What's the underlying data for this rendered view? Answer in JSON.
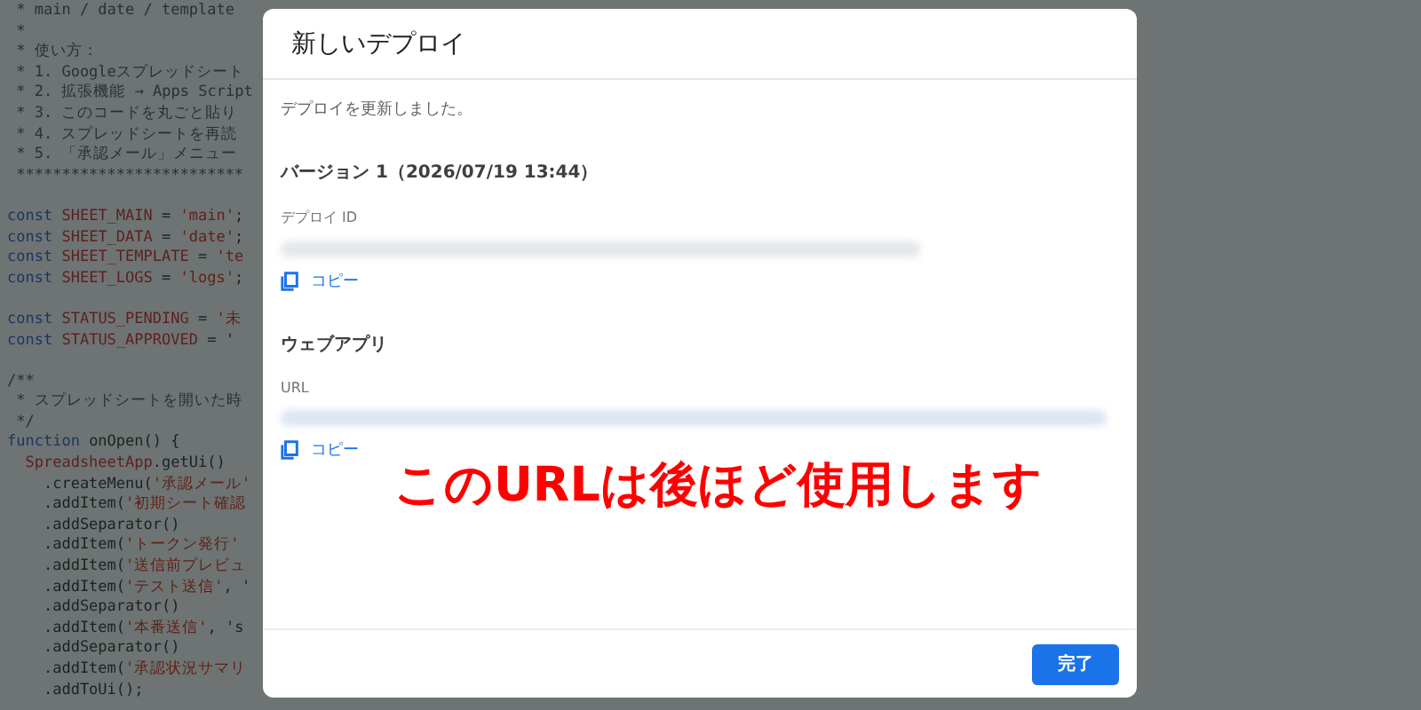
{
  "editor": {
    "blocks": [
      [
        [
          {
            "kind": "comment",
            "text": " * main / date / template"
          }
        ],
        [
          {
            "kind": "comment",
            "text": " *"
          }
        ],
        [
          {
            "kind": "comment",
            "text": " * 使い方："
          }
        ],
        [
          {
            "kind": "comment",
            "text": " * 1. Googleスプレッドシート"
          }
        ],
        [
          {
            "kind": "comment",
            "text": " * 2. 拡張機能 → Apps Script"
          }
        ],
        [
          {
            "kind": "comment",
            "text": " * 3. このコードを丸ごと貼り"
          }
        ],
        [
          {
            "kind": "comment",
            "text": " * 4. スプレッドシートを再読"
          }
        ],
        [
          {
            "kind": "comment",
            "text": " * 5. 「承認メール」メニュー"
          }
        ],
        [
          {
            "kind": "comment",
            "text": " *************************"
          }
        ]
      ],
      [
        [
          {
            "kind": "keyword",
            "text": "const "
          },
          {
            "kind": "name",
            "text": "SHEET_MAIN"
          },
          {
            "kind": "plain",
            "text": " = "
          },
          {
            "kind": "string",
            "text": "'main'"
          },
          {
            "kind": "plain",
            "text": ";"
          }
        ],
        [
          {
            "kind": "keyword",
            "text": "const "
          },
          {
            "kind": "name",
            "text": "SHEET_DATA"
          },
          {
            "kind": "plain",
            "text": " = "
          },
          {
            "kind": "string",
            "text": "'date'"
          },
          {
            "kind": "plain",
            "text": ";"
          }
        ],
        [
          {
            "kind": "keyword",
            "text": "const "
          },
          {
            "kind": "name",
            "text": "SHEET_TEMPLATE"
          },
          {
            "kind": "plain",
            "text": " = "
          },
          {
            "kind": "string",
            "text": "'te"
          }
        ],
        [
          {
            "kind": "keyword",
            "text": "const "
          },
          {
            "kind": "name",
            "text": "SHEET_LOGS"
          },
          {
            "kind": "plain",
            "text": " = "
          },
          {
            "kind": "string",
            "text": "'logs'"
          },
          {
            "kind": "plain",
            "text": ";"
          }
        ]
      ],
      [
        [
          {
            "kind": "keyword",
            "text": "const "
          },
          {
            "kind": "name",
            "text": "STATUS_PENDING"
          },
          {
            "kind": "plain",
            "text": " = "
          },
          {
            "kind": "string",
            "text": "'未"
          }
        ],
        [
          {
            "kind": "keyword",
            "text": "const "
          },
          {
            "kind": "name",
            "text": "STATUS_APPROVED"
          },
          {
            "kind": "plain",
            "text": " = '"
          }
        ]
      ],
      [
        [
          {
            "kind": "comment",
            "text": "/**"
          }
        ],
        [
          {
            "kind": "comment",
            "text": " * スプレッドシートを開いた時"
          }
        ],
        [
          {
            "kind": "comment",
            "text": " */"
          }
        ],
        [
          {
            "kind": "keyword",
            "text": "function "
          },
          {
            "kind": "plain",
            "text": "onOpen() {"
          }
        ],
        [
          {
            "kind": "name",
            "text": "  SpreadsheetApp"
          },
          {
            "kind": "plain",
            "text": ".getUi()"
          }
        ],
        [
          {
            "kind": "plain",
            "text": "    .createMenu("
          },
          {
            "kind": "string",
            "text": "'承認メール'"
          }
        ],
        [
          {
            "kind": "plain",
            "text": "    .addItem("
          },
          {
            "kind": "string",
            "text": "'初期シート確認"
          }
        ],
        [
          {
            "kind": "plain",
            "text": "    .addSeparator()"
          }
        ],
        [
          {
            "kind": "plain",
            "text": "    .addItem("
          },
          {
            "kind": "string",
            "text": "'トークン発行'"
          }
        ],
        [
          {
            "kind": "plain",
            "text": "    .addItem("
          },
          {
            "kind": "string",
            "text": "'送信前プレビュ"
          }
        ],
        [
          {
            "kind": "plain",
            "text": "    .addItem("
          },
          {
            "kind": "string",
            "text": "'テスト送信'"
          },
          {
            "kind": "plain",
            "text": ", '"
          }
        ],
        [
          {
            "kind": "plain",
            "text": "    .addSeparator()"
          }
        ],
        [
          {
            "kind": "plain",
            "text": "    .addItem("
          },
          {
            "kind": "string",
            "text": "'本番送信'"
          },
          {
            "kind": "plain",
            "text": ", 's"
          }
        ],
        [
          {
            "kind": "plain",
            "text": "    .addSeparator()"
          }
        ],
        [
          {
            "kind": "plain",
            "text": "    .addItem("
          },
          {
            "kind": "string",
            "text": "'承認状況サマリ"
          }
        ],
        [
          {
            "kind": "plain",
            "text": "    .addToUi();"
          }
        ]
      ]
    ]
  },
  "dialog": {
    "title": "新しいデプロイ",
    "message": "デプロイを更新しました。",
    "version": "バージョン 1（2026/07/19 13:44）",
    "sections": [
      {
        "label": "デプロイ ID",
        "kind": "id",
        "copy": "コピー"
      },
      {
        "heading": "ウェブアプリ",
        "label": "URL",
        "kind": "url",
        "copy": "コピー"
      }
    ],
    "button": "完了"
  },
  "annotation": "このURLは後ほど使用します"
}
